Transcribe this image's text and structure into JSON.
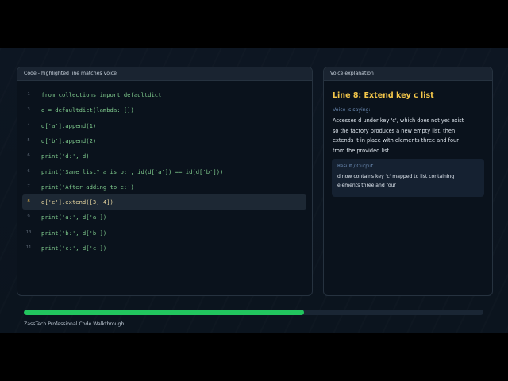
{
  "code_panel": {
    "header": "Code - highlighted line matches voice"
  },
  "code_lines": [
    {
      "num": "1",
      "text": "from collections import defaultdict"
    },
    {
      "num": "3",
      "text": "d = defaultdict(lambda: [])"
    },
    {
      "num": "4",
      "text": "d['a'].append(1)"
    },
    {
      "num": "5",
      "text": "d['b'].append(2)"
    },
    {
      "num": "6",
      "text": "print('d:', d)"
    },
    {
      "num": "6",
      "text": "print('Same list? a is b:', id(d['a']) == id(d['b']))"
    },
    {
      "num": "7",
      "text": "print('After adding to c:')"
    },
    {
      "num": "8",
      "text": "d['c'].extend([3, 4])"
    },
    {
      "num": "9",
      "text": "print('a:', d['a'])"
    },
    {
      "num": "10",
      "text": "print('b:', d['b'])"
    },
    {
      "num": "11",
      "text": "print('c:', d['c'])"
    }
  ],
  "active_line_index": 7,
  "voice_panel": {
    "header": "Voice explanation",
    "title": "Line 8: Extend key c list",
    "subtitle": "Voice is saying:",
    "text": "Accesses d under key 'c', which does not yet exist so the factory produces a new empty list, then extends it in place with elements three and four from the provided list.",
    "result_label": "Result / Output",
    "result_text": "d now contains key 'c' mapped to list containing elements three and four"
  },
  "progress": {
    "fraction": 0.61,
    "color": "#22c55e"
  },
  "footer": {
    "text": "ZassTech Professional Code Walkthrough"
  }
}
